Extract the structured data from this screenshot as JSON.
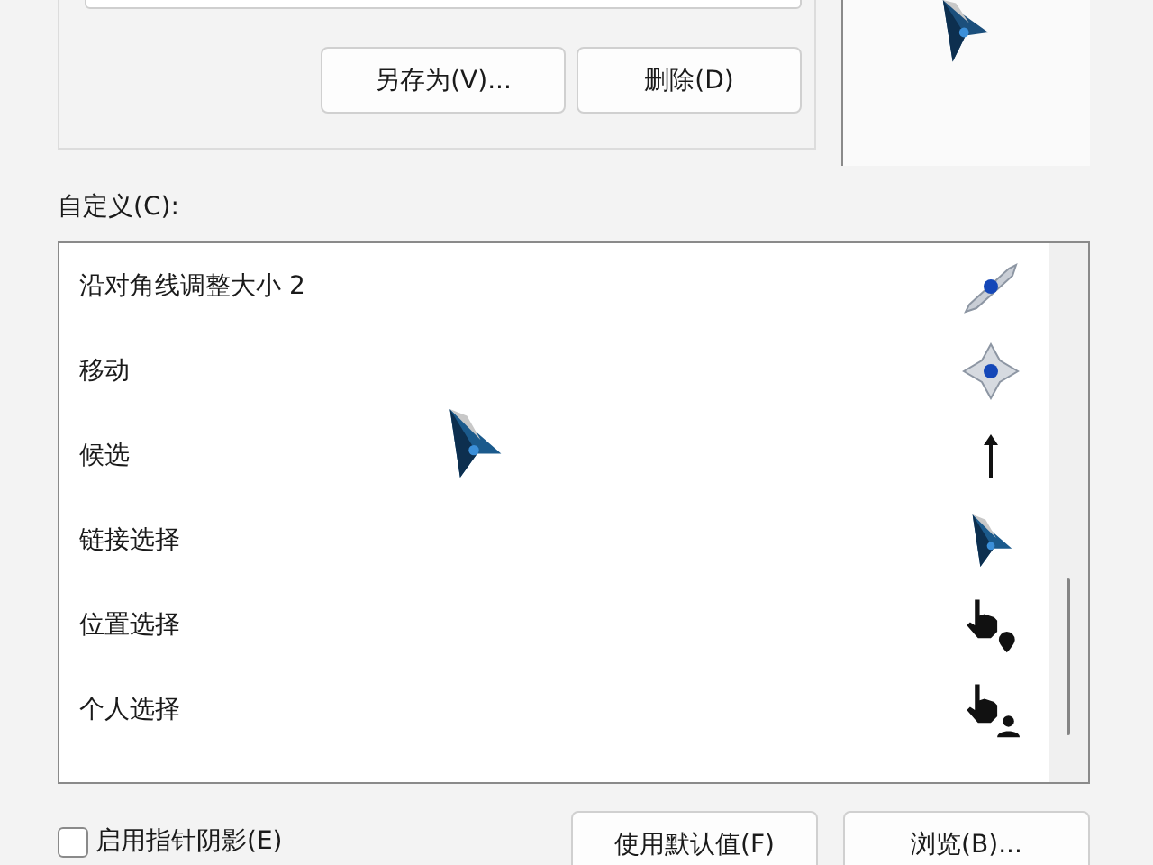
{
  "scheme_buttons": [
    "另存为(V)...",
    "删除(D)"
  ],
  "custom_label": "自定义(C):",
  "cursors": [
    {
      "name": "沿对角线调整大小 2",
      "kind": "diagonal",
      "selected": false
    },
    {
      "name": "移动",
      "kind": "move",
      "selected": false
    },
    {
      "name": "候选",
      "kind": "up",
      "selected": false
    },
    {
      "name": "链接选择",
      "kind": "arrow",
      "selected": false
    },
    {
      "name": "位置选择",
      "kind": "hand-pin",
      "selected": false
    },
    {
      "name": "个人选择",
      "kind": "hand-person",
      "selected": false
    }
  ],
  "shadow": {
    "label": "启用指针阴影(E)",
    "checked": false
  },
  "buttons": [
    "使用默认值(F)",
    "浏览(B)..."
  ]
}
